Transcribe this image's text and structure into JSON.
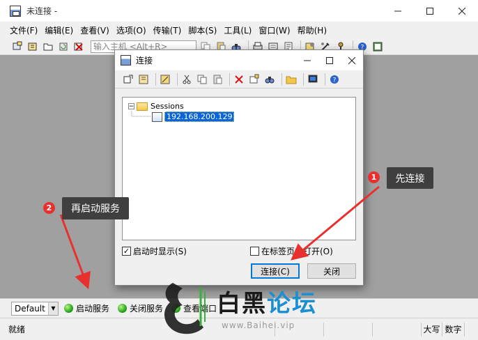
{
  "window": {
    "title": "未连接 -",
    "controls": [
      "minimize",
      "maximize",
      "close"
    ]
  },
  "menu": [
    "文件(F)",
    "编辑(E)",
    "查看(V)",
    "选项(O)",
    "传输(T)",
    "脚本(S)",
    "工具(L)",
    "窗口(W)",
    "帮助(H)"
  ],
  "toolbar": {
    "host_placeholder": "输入主机 <Alt+R>"
  },
  "dialog": {
    "title": "连接",
    "tree": {
      "root": "Sessions",
      "session": "192.168.200.129"
    },
    "checkbox_startup": "启动时显示(S)",
    "checkbox_startup_checked": true,
    "checkbox_tab": "在标签页中打开(O)",
    "checkbox_tab_checked": false,
    "connect_button": "连接(C)",
    "close_button": "关闭"
  },
  "buttonbar": {
    "session": "Default",
    "buttons": [
      "启动服务",
      "关闭服务",
      "查看端口"
    ]
  },
  "statusbar": {
    "status": "就绪",
    "cells": [
      "大写",
      "数字"
    ]
  },
  "annotations": {
    "step1_number": "1",
    "step1_label": "先连接",
    "step2_number": "2",
    "step2_label": "再启动服务",
    "accent_color": "#e8312f"
  },
  "watermark": {
    "title_part1": "白黑",
    "title_part2": "论坛",
    "url": "www.Baihei.vip"
  }
}
